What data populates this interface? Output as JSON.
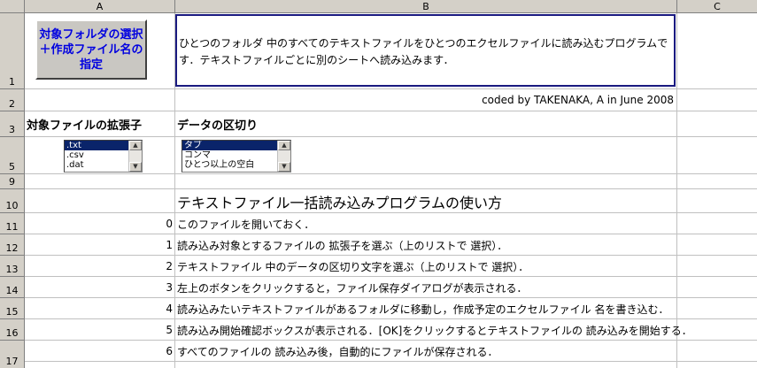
{
  "sheet": {
    "columns": [
      "A",
      "B",
      "C"
    ],
    "rows": [
      "1",
      "2",
      "3",
      "5",
      "9",
      "10",
      "11",
      "12",
      "13",
      "14",
      "15",
      "16",
      "17"
    ]
  },
  "button": {
    "label": "対象フォルダの選択＋作成ファイル名の指定"
  },
  "description": "ひとつのフォルダ 中のすべてのテキストファイルをひとつのエクセルファイルに読み込むプログラムです．テキストファイルごとに別のシートへ読み込みます．",
  "credit": "coded by TAKENAKA, A in June 2008",
  "headers": {
    "extension": "対象ファイルの拡張子",
    "delimiter": "データの区切り"
  },
  "ext_list": {
    "items": [
      ".txt",
      ".csv",
      ".dat"
    ],
    "selected": ".txt"
  },
  "delim_list": {
    "items": [
      "タブ",
      "コンマ",
      "ひとつ以上の空白"
    ],
    "selected": "タブ"
  },
  "howto": {
    "title": "テキストファイル一括読み込みプログラムの使い方",
    "steps": [
      {
        "num": "0",
        "text": "このファイルを開いておく．"
      },
      {
        "num": "1",
        "text": "読み込み対象とするファイルの 拡張子を選ぶ（上のリストで 選択）．"
      },
      {
        "num": "2",
        "text": "テキストファイル 中のデータの区切り文字を選ぶ（上のリストで 選択）．"
      },
      {
        "num": "3",
        "text": "左上のボタンをクリックすると，ファイル保存ダイアログが表示される．"
      },
      {
        "num": "4",
        "text": "読み込みたいテキストファイルがあるフォルダに移動し，作成予定のエクセルファイル 名を書き込む．"
      },
      {
        "num": "5",
        "text": "読み込み開始確認ボックスが表示される．[OK]をクリックするとテキストファイルの 読み込みを開始する．"
      },
      {
        "num": "6",
        "text": "すべてのファイルの 読み込み後，自動的にファイルが保存される．"
      }
    ]
  },
  "colors": {
    "button_text": "#0000e0",
    "header_bg": "#d4d0c8",
    "selection": "#0a246a"
  }
}
